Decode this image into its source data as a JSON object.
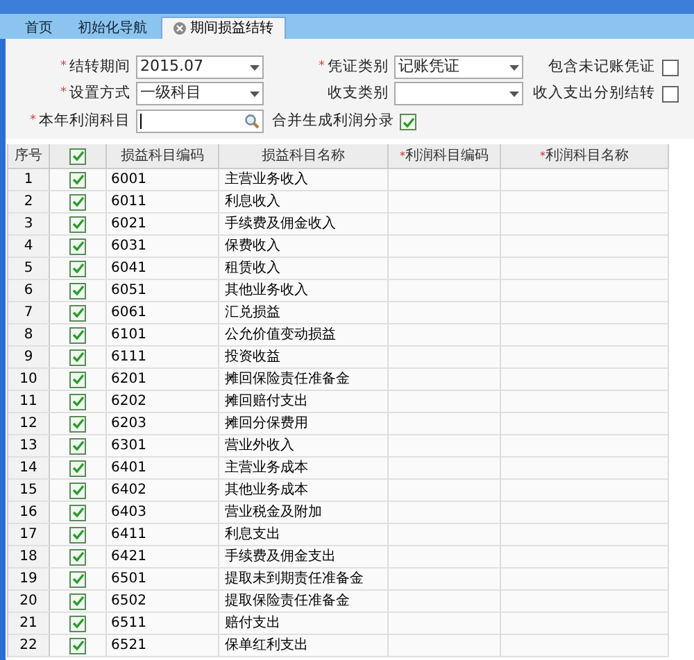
{
  "tabs": [
    {
      "label": "首页",
      "selected": false,
      "closable": false
    },
    {
      "label": "初始化导航",
      "selected": false,
      "closable": false
    },
    {
      "label": "期间损益结转",
      "selected": true,
      "closable": true
    }
  ],
  "form": {
    "period": {
      "marker": "*",
      "label": "结转期间",
      "value": "2015.07"
    },
    "voucher_type": {
      "marker": "*",
      "label": "凭证类别",
      "value": "记账凭证"
    },
    "include_unposted": {
      "label": "包含未记账凭证",
      "checked": false
    },
    "setup_mode": {
      "marker": "*",
      "label": "设置方式",
      "value": "一级科目"
    },
    "income_type": {
      "label": "收支类别"
    },
    "separate": {
      "label": "收入支出分别结转",
      "checked": false
    },
    "profit_account": {
      "marker": "*",
      "label": "本年利润科目"
    },
    "merge": {
      "label": "合并生成利润分录",
      "checked": true
    }
  },
  "table": {
    "columns": [
      {
        "label": "序号",
        "kind": "text"
      },
      {
        "kind": "check",
        "checked": true
      },
      {
        "label": "损益科目编码",
        "kind": "text"
      },
      {
        "label": "损益科目名称",
        "kind": "text"
      },
      {
        "marker": "*",
        "label": "利润科目编码",
        "kind": "text"
      },
      {
        "marker": "*",
        "label": "利润科目名称",
        "kind": "text"
      }
    ],
    "rows": [
      {
        "no": "1",
        "checked": true,
        "code": "6001",
        "name": "主营业务收入"
      },
      {
        "no": "2",
        "checked": true,
        "code": "6011",
        "name": "利息收入"
      },
      {
        "no": "3",
        "checked": true,
        "code": "6021",
        "name": "手续费及佣金收入"
      },
      {
        "no": "4",
        "checked": true,
        "code": "6031",
        "name": "保费收入"
      },
      {
        "no": "5",
        "checked": true,
        "code": "6041",
        "name": "租赁收入"
      },
      {
        "no": "6",
        "checked": true,
        "code": "6051",
        "name": "其他业务收入"
      },
      {
        "no": "7",
        "checked": true,
        "code": "6061",
        "name": "汇兑损益"
      },
      {
        "no": "8",
        "checked": true,
        "code": "6101",
        "name": "公允价值变动损益"
      },
      {
        "no": "9",
        "checked": true,
        "code": "6111",
        "name": "投资收益"
      },
      {
        "no": "10",
        "checked": true,
        "code": "6201",
        "name": "摊回保险责任准备金"
      },
      {
        "no": "11",
        "checked": true,
        "code": "6202",
        "name": "摊回赔付支出"
      },
      {
        "no": "12",
        "checked": true,
        "code": "6203",
        "name": "摊回分保费用"
      },
      {
        "no": "13",
        "checked": true,
        "code": "6301",
        "name": "营业外收入"
      },
      {
        "no": "14",
        "checked": true,
        "code": "6401",
        "name": "主营业务成本"
      },
      {
        "no": "15",
        "checked": true,
        "code": "6402",
        "name": "其他业务成本"
      },
      {
        "no": "16",
        "checked": true,
        "code": "6403",
        "name": "营业税金及附加"
      },
      {
        "no": "17",
        "checked": true,
        "code": "6411",
        "name": "利息支出"
      },
      {
        "no": "18",
        "checked": true,
        "code": "6421",
        "name": "手续费及佣金支出"
      },
      {
        "no": "19",
        "checked": true,
        "code": "6501",
        "name": "提取未到期责任准备金"
      },
      {
        "no": "20",
        "checked": true,
        "code": "6502",
        "name": "提取保险责任准备金"
      },
      {
        "no": "21",
        "checked": true,
        "code": "6511",
        "name": "赔付支出"
      },
      {
        "no": "22",
        "checked": true,
        "code": "6521",
        "name": "保单红利支出"
      }
    ]
  }
}
